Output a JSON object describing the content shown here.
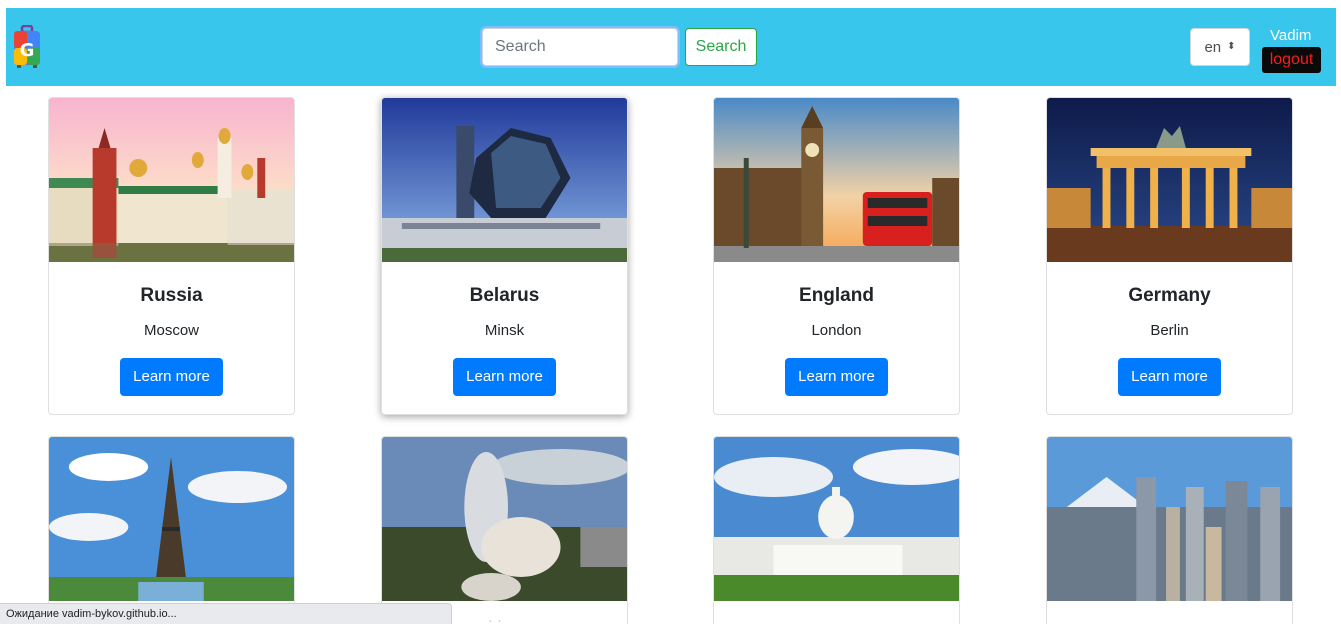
{
  "header": {
    "logo_icon": "g-suitcase-logo-icon",
    "search": {
      "placeholder": "Search",
      "value": "",
      "button_label": "Search"
    },
    "language": {
      "selected": "en"
    },
    "user": {
      "name": "Vadim",
      "logout_label": "logout"
    },
    "colors": {
      "bar": "#38c6ec",
      "search_button": "#28a745",
      "logout_bg": "#0a0a0a",
      "logout_text": "#ff1a1a"
    }
  },
  "cards": [
    {
      "country": "Russia",
      "capital": "Moscow",
      "button_label": "Learn more",
      "image": "kremlin-photo"
    },
    {
      "country": "Belarus",
      "capital": "Minsk",
      "button_label": "Learn more",
      "image": "national-library-photo"
    },
    {
      "country": "England",
      "capital": "London",
      "button_label": "Learn more",
      "image": "big-ben-photo"
    },
    {
      "country": "Germany",
      "capital": "Berlin",
      "button_label": "Learn more",
      "image": "brandenburg-gate-photo"
    },
    {
      "image": "eiffel-tower-photo"
    },
    {
      "image": "galaxy-soho-photo"
    },
    {
      "image": "capitol-building-photo"
    },
    {
      "image": "tokyo-fuji-photo"
    }
  ],
  "button_color": "#007bff",
  "status_bar": {
    "text": "Ожидание vadim-bykov.github.io..."
  }
}
